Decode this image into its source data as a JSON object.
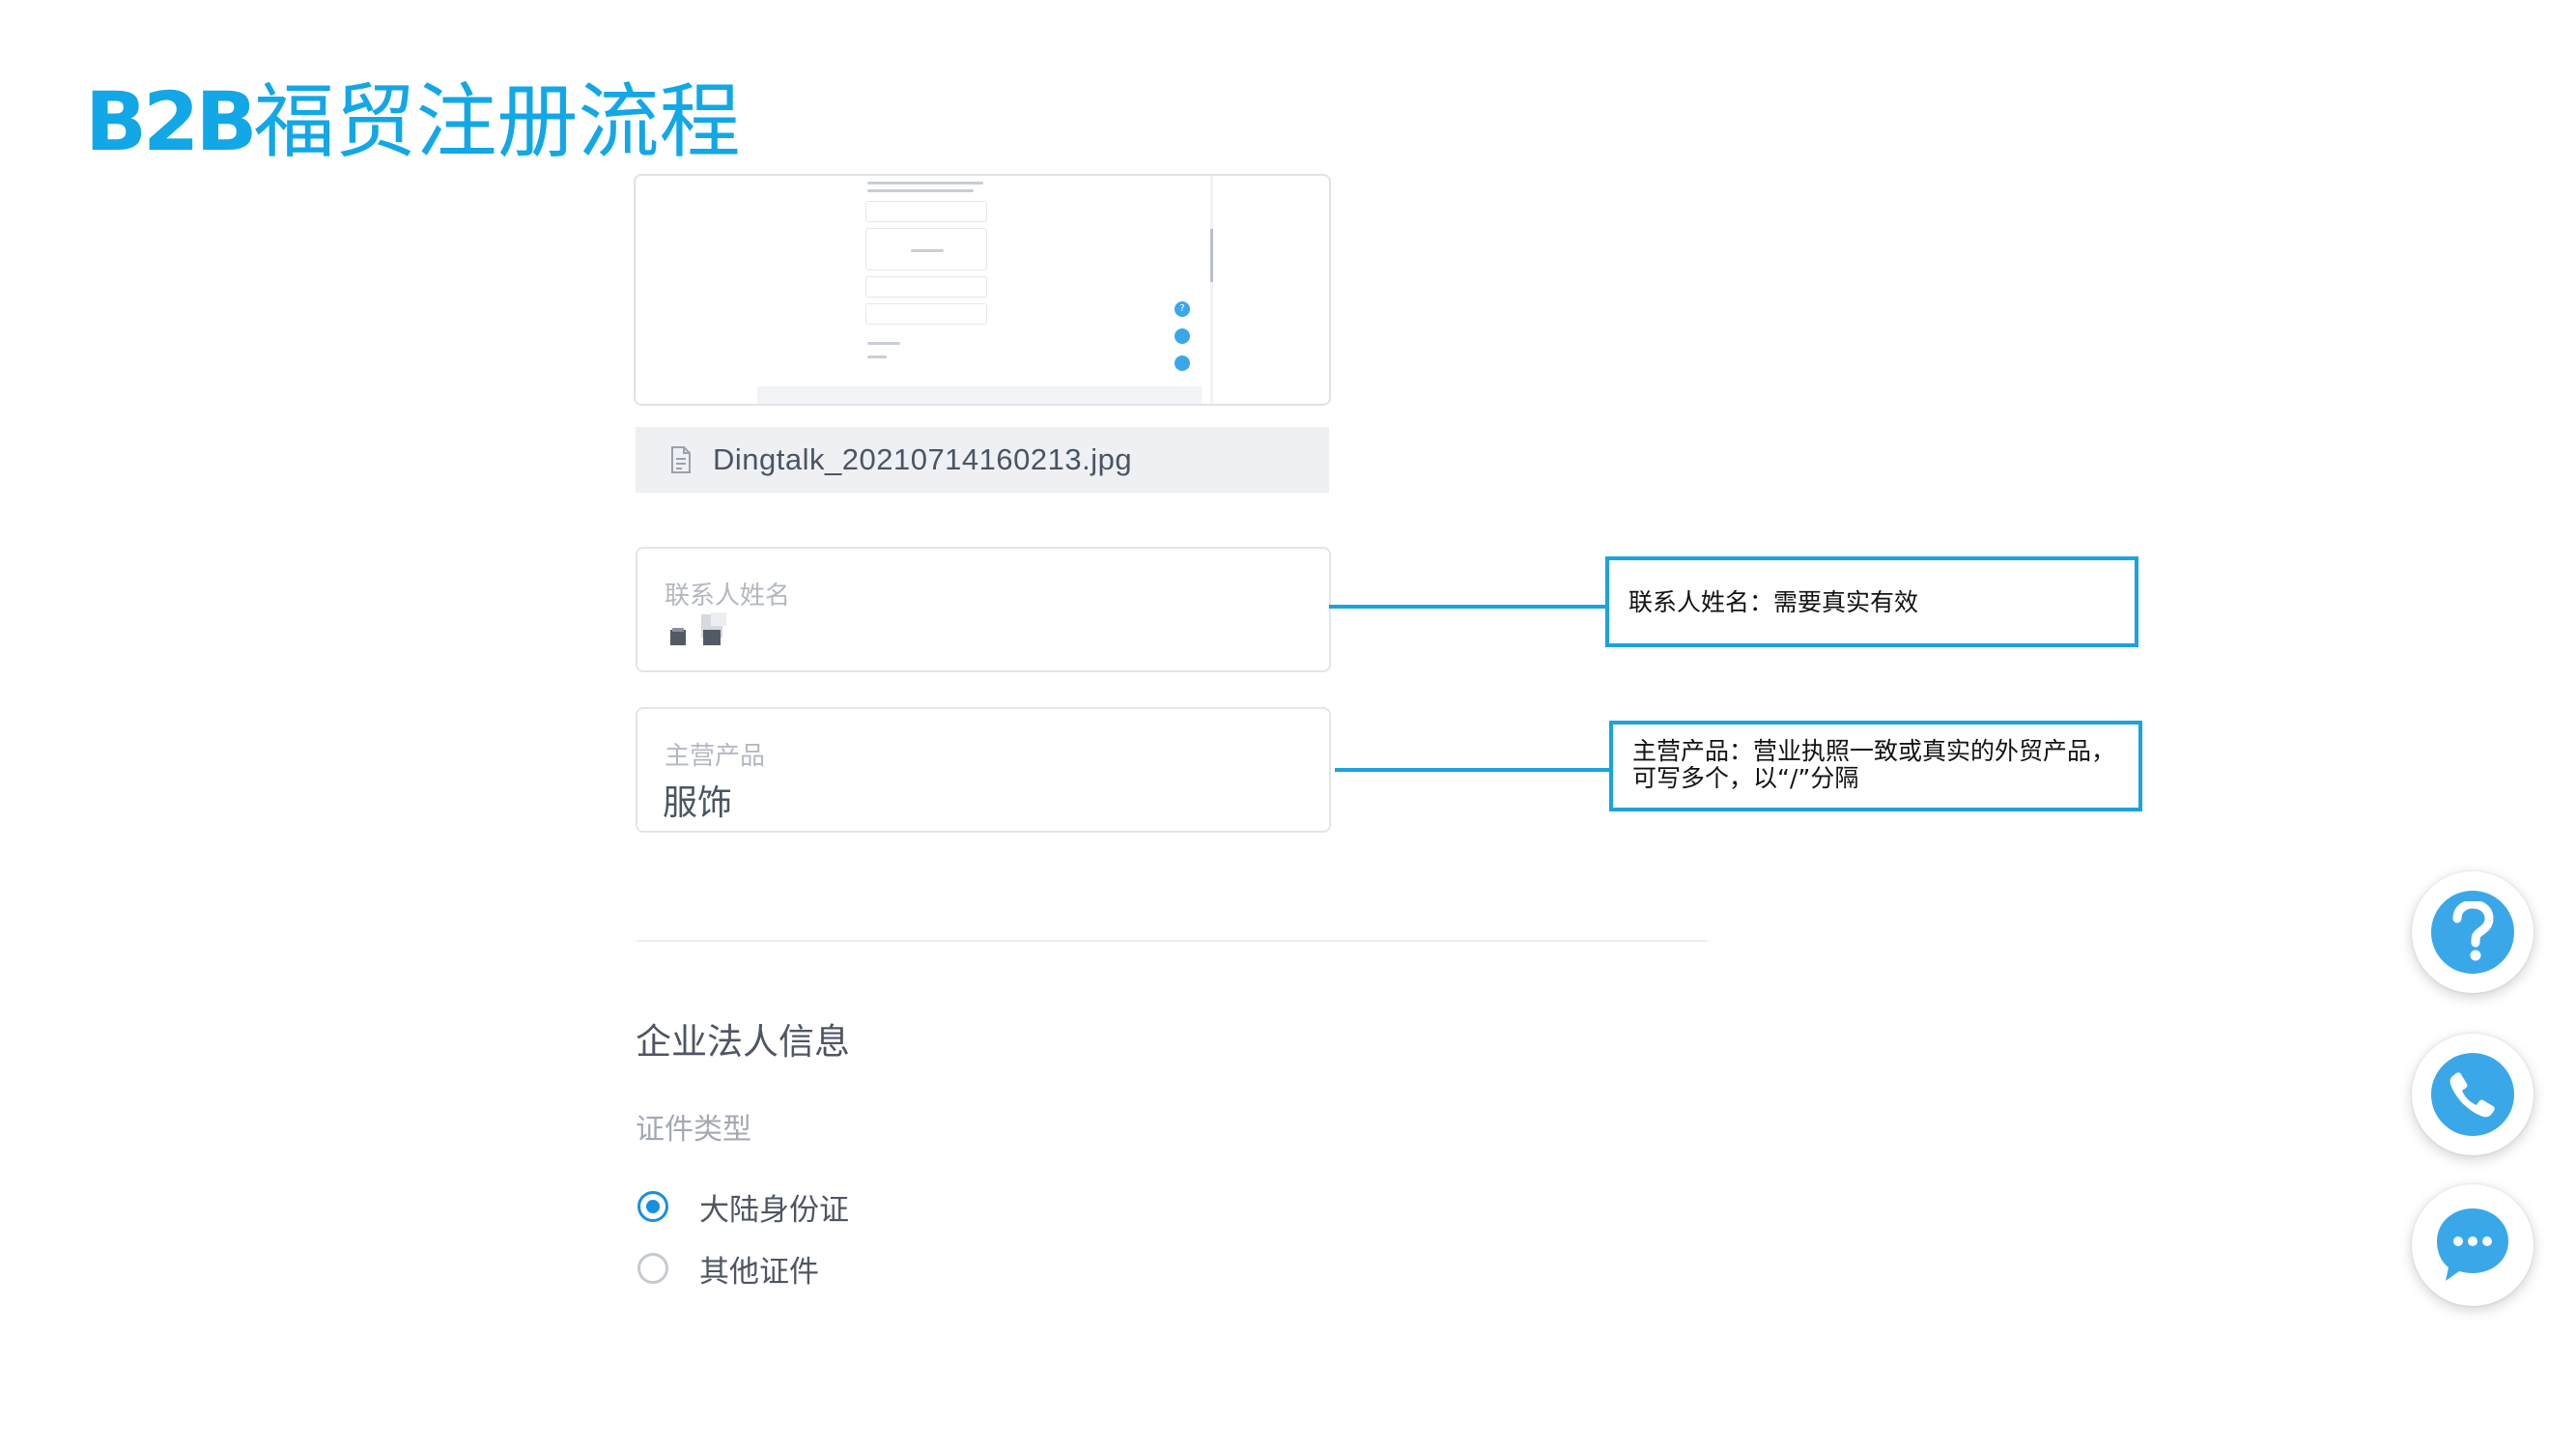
{
  "slide": {
    "title_latin": "B2B",
    "title_cjk": "福贸注册流程"
  },
  "attachment": {
    "file_name": "Dingtalk_20210714160213.jpg",
    "icon": "document-icon"
  },
  "form": {
    "contact_name": {
      "label": "联系人姓名",
      "value_obscured": true
    },
    "main_products": {
      "label": "主营产品",
      "value": "服饰"
    }
  },
  "callouts": {
    "contact_name_note": "联系人姓名：需要真实有效",
    "main_products_note_line1": "主营产品：营业执照一致或真实的外贸产品，",
    "main_products_note_line2": "可写多个，以“/”分隔"
  },
  "legal_person": {
    "section_title": "企业法人信息",
    "id_type_label": "证件类型",
    "options": [
      {
        "label": "大陆身份证",
        "selected": true
      },
      {
        "label": "其他证件",
        "selected": false
      }
    ]
  },
  "floating_buttons": [
    {
      "icon": "help-icon"
    },
    {
      "icon": "phone-icon"
    },
    {
      "icon": "chat-icon"
    }
  ],
  "colors": {
    "title": "#12a7e6",
    "callout_border": "#1aa3dc",
    "radio_accent": "#1890e0",
    "fab": "#3aa8e8"
  }
}
